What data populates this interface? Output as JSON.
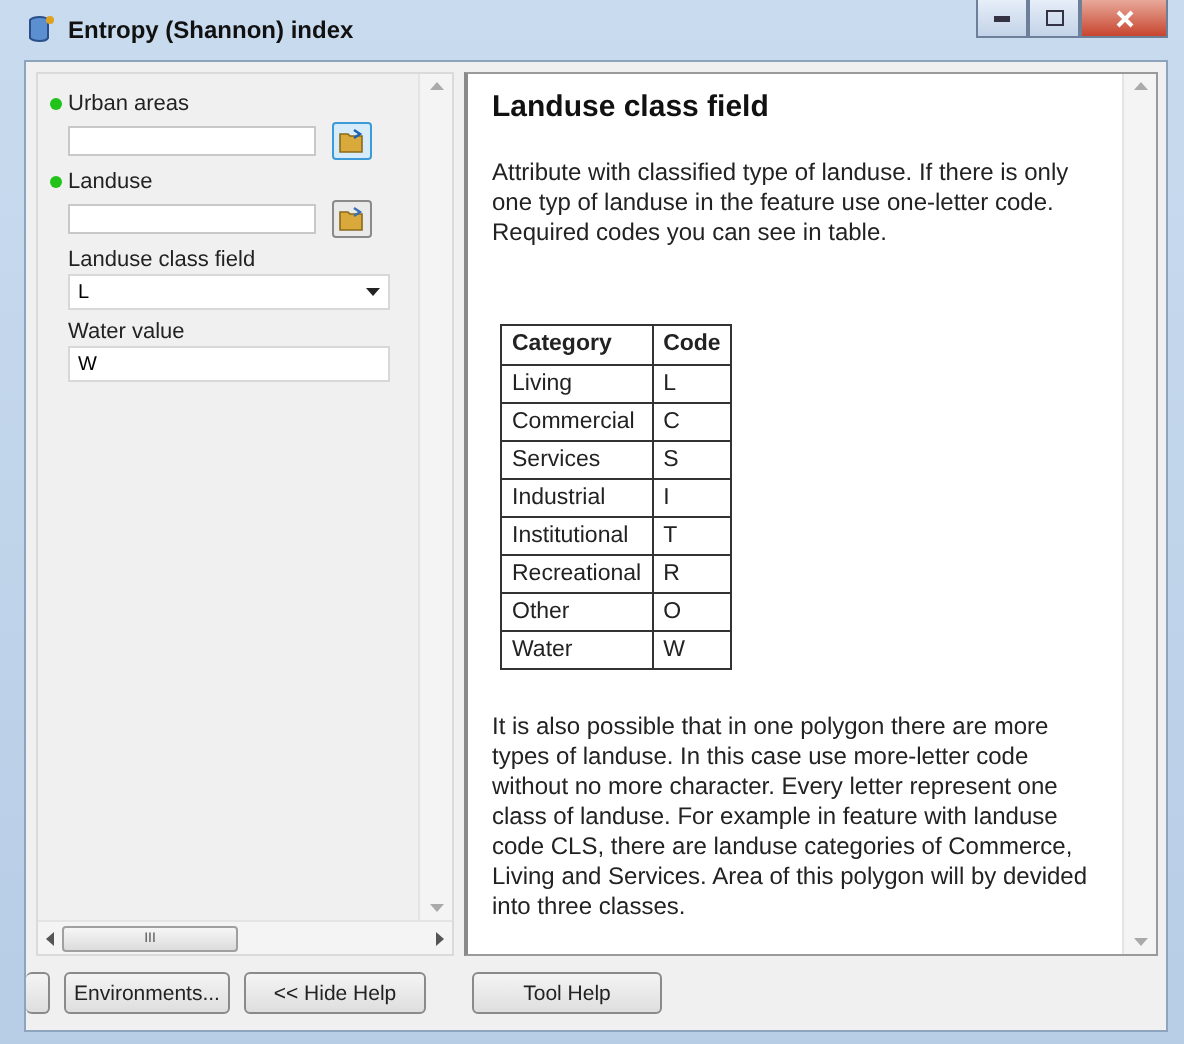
{
  "window": {
    "title": "Entropy (Shannon) index"
  },
  "parameters": [
    {
      "kind": "dataset",
      "label": "Urban areas",
      "required": true
    },
    {
      "kind": "dataset",
      "label": "Landuse",
      "required": true
    },
    {
      "kind": "dropdown",
      "label": "Landuse class field",
      "required": false,
      "value": "L"
    },
    {
      "kind": "text",
      "label": "Water value",
      "required": false,
      "value": "W"
    }
  ],
  "scroll_thumb_glyph": "III",
  "help": {
    "title": "Landuse class field",
    "intro": "Attribute with classified type of landuse. If there is only one typ of landuse in the feature use one-letter code. Required codes you can see in table.",
    "table": {
      "columns": [
        "Category",
        "Code"
      ],
      "rows": [
        [
          "Living",
          "L"
        ],
        [
          "Commercial",
          "C"
        ],
        [
          "Services",
          "S"
        ],
        [
          "Industrial",
          "I"
        ],
        [
          "Institutional",
          "T"
        ],
        [
          "Recreational",
          "R"
        ],
        [
          "Other",
          "O"
        ],
        [
          "Water",
          "W"
        ]
      ]
    },
    "body": "It is also possible that in one polygon there are more types of landuse. In this case use more-letter code without no more character. Every letter represent one class of landuse. For example in feature with landuse code CLS, there are landuse categories of Commerce, Living and Services. Area of this polygon will by devided into three classes."
  },
  "buttons": [
    "Environments...",
    "<< Hide Help",
    "Tool Help"
  ]
}
